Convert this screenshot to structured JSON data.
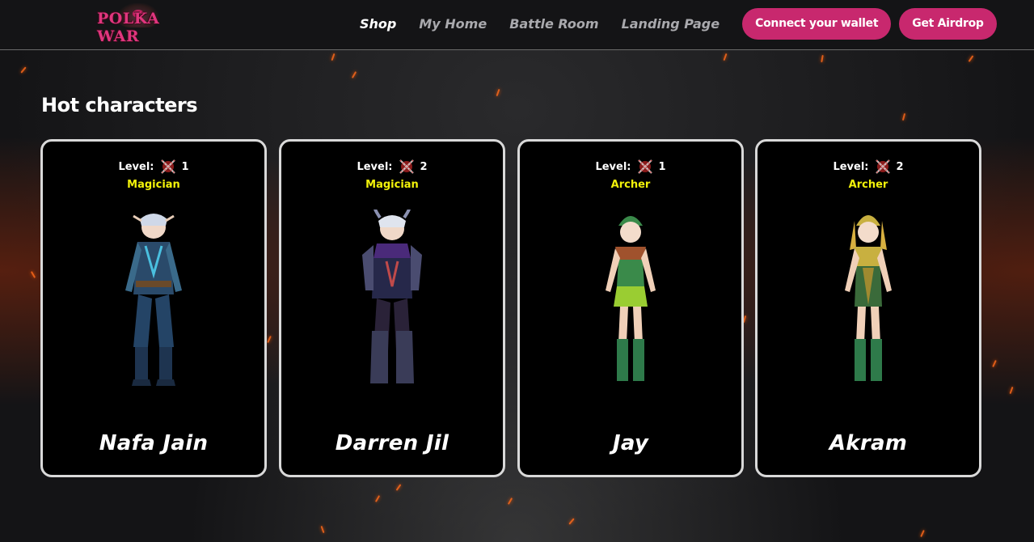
{
  "header": {
    "logo_text": "POLKA WAR",
    "nav": [
      {
        "label": "Shop",
        "active": true
      },
      {
        "label": "My Home",
        "active": false
      },
      {
        "label": "Battle Room",
        "active": false
      },
      {
        "label": "Landing Page",
        "active": false
      }
    ],
    "connect_wallet_label": "Connect your wallet",
    "airdrop_label": "Get Airdrop",
    "accent_color": "#c8286e"
  },
  "section": {
    "title": "Hot characters"
  },
  "level_label": "Level:",
  "characters": [
    {
      "name": "Nafa Jain",
      "level": "1",
      "class": "Magician",
      "theme": "magician-blue"
    },
    {
      "name": "Darren Jil",
      "level": "2",
      "class": "Magician",
      "theme": "magician-dark"
    },
    {
      "name": "Jay",
      "level": "1",
      "class": "Archer",
      "theme": "archer-green"
    },
    {
      "name": "Akram",
      "level": "2",
      "class": "Archer",
      "theme": "archer-gold"
    }
  ]
}
